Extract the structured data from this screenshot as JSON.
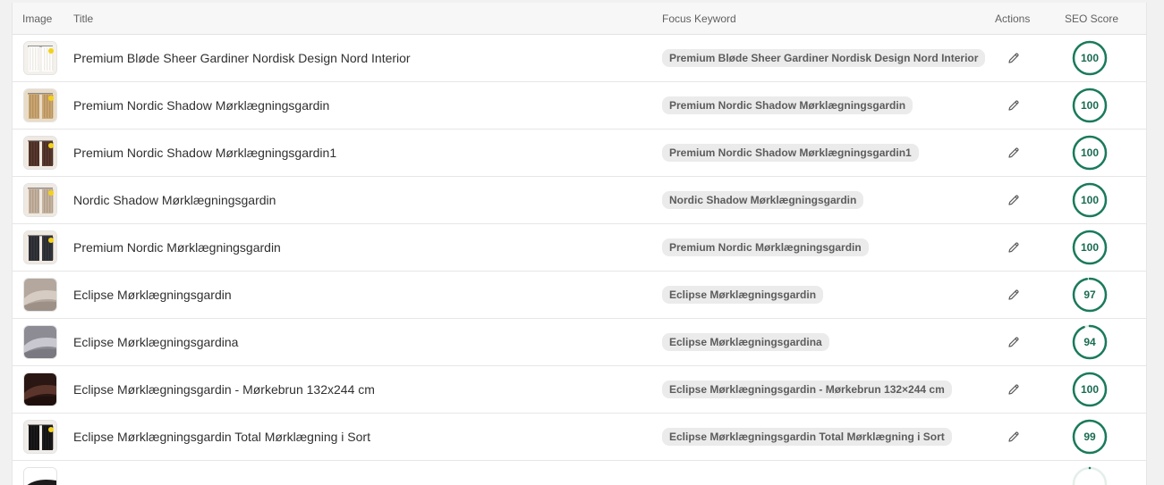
{
  "header": {
    "image": "Image",
    "title": "Title",
    "focus_keyword": "Focus Keyword",
    "actions": "Actions",
    "seo_score": "SEO Score"
  },
  "colors": {
    "score_ring": "#1a7a5c",
    "score_text": "#1a6b52",
    "keyword_bg": "#ebebeb"
  },
  "rows": [
    {
      "title": "Premium Bløde Sheer Gardiner Nordisk Design Nord Interior",
      "keyword": "Premium Bløde Sheer Gardiner Nordisk Design Nord Interior",
      "score": "100",
      "thumb": "sheer-white-curtain"
    },
    {
      "title": "Premium Nordic Shadow Mørklægningsgardin",
      "keyword": "Premium Nordic Shadow Mørklægningsgardin",
      "score": "100",
      "thumb": "beige-curtain"
    },
    {
      "title": "Premium Nordic Shadow Mørklægningsgardin1",
      "keyword": "Premium Nordic Shadow Mørklægningsgardin1",
      "score": "100",
      "thumb": "brown-curtain"
    },
    {
      "title": "Nordic Shadow Mørklægningsgardin",
      "keyword": "Nordic Shadow Mørklægningsgardin",
      "score": "100",
      "thumb": "taupe-curtain"
    },
    {
      "title": "Premium Nordic Mørklægningsgardin",
      "keyword": "Premium Nordic Mørklægningsgardin",
      "score": "100",
      "thumb": "dark-curtain"
    },
    {
      "title": "Eclipse Mørklægningsgardin",
      "keyword": "Eclipse Mørklægningsgardin",
      "score": "97",
      "thumb": "taupe-fabric"
    },
    {
      "title": "Eclipse Mørklægningsgardina",
      "keyword": "Eclipse Mørklægningsgardina",
      "score": "94",
      "thumb": "grey-fabric"
    },
    {
      "title": "Eclipse Mørklægningsgardin - Mørkebrun 132x244 cm",
      "keyword": "Eclipse Mørklægningsgardin - Mørkebrun 132×244 cm",
      "score": "100",
      "thumb": "dark-brown-fabric"
    },
    {
      "title": "Eclipse Mørklægningsgardin Total Mørklægning i Sort",
      "keyword": "Eclipse Mørklægningsgardin Total Mørklægning i Sort",
      "score": "99",
      "thumb": "black-curtain"
    },
    {
      "title": "",
      "keyword": "",
      "score": "",
      "thumb": "partial-item"
    }
  ]
}
